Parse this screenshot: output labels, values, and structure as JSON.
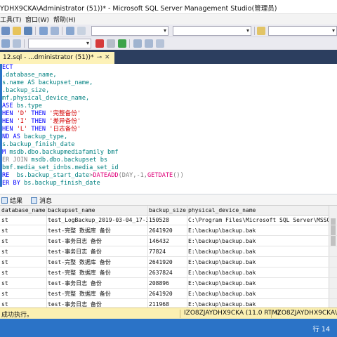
{
  "window": {
    "title": "YDHX9CKA\\Administrator (51))* - Microsoft SQL Server Management Studio(管理员)"
  },
  "menu": {
    "items": [
      "工具(T)",
      "窗口(W)",
      "帮助(H)"
    ]
  },
  "tab": {
    "label": "12.sql - ...dministrator (51))*"
  },
  "code": {
    "lines": [
      [
        {
          "t": "ECT",
          "c": "kw"
        }
      ],
      [
        {
          "t": ".database_name,",
          "c": "tx"
        }
      ],
      [
        {
          "t": "s.name AS backupset_name,",
          "c": "tx"
        }
      ],
      [
        {
          "t": ".backup_size,",
          "c": "tx"
        }
      ],
      [
        {
          "t": "mf.physical_device_name,",
          "c": "tx"
        }
      ],
      [
        {
          "t": "ASE ",
          "c": "kw"
        },
        {
          "t": "bs.type",
          "c": "tx"
        }
      ],
      [
        {
          "t": "HEN ",
          "c": "kw"
        },
        {
          "t": "'D'",
          "c": "str"
        },
        {
          "t": " THEN ",
          "c": "kw"
        },
        {
          "t": "'完整备份'",
          "c": "str"
        }
      ],
      [
        {
          "t": "HEN ",
          "c": "kw"
        },
        {
          "t": "'I'",
          "c": "str"
        },
        {
          "t": " THEN ",
          "c": "kw"
        },
        {
          "t": "'差异备份'",
          "c": "str"
        }
      ],
      [
        {
          "t": "HEN ",
          "c": "kw"
        },
        {
          "t": "'L'",
          "c": "str"
        },
        {
          "t": " THEN ",
          "c": "kw"
        },
        {
          "t": "'日志备份'",
          "c": "str"
        }
      ],
      [
        {
          "t": "ND AS ",
          "c": "kw"
        },
        {
          "t": "backup_type,",
          "c": "tx"
        }
      ],
      [
        {
          "t": "s.backup_finish_date",
          "c": "tx"
        }
      ],
      [
        {
          "t": "M ",
          "c": "kw"
        },
        {
          "t": "msdb.dbo.backupmediafamily bmf",
          "c": "tx"
        }
      ],
      [
        {
          "t": "ER JOIN ",
          "c": "op"
        },
        {
          "t": "msdb.dbo.backupset bs",
          "c": "tx"
        }
      ],
      [
        {
          "t": "bmf.media_set_id=bs.media_set_id",
          "c": "tx"
        }
      ],
      [
        {
          "t": "RE  ",
          "c": "kw"
        },
        {
          "t": "bs.backup_start_date",
          "c": "tx"
        },
        {
          "t": ">",
          "c": "op"
        },
        {
          "t": "DATEADD",
          "c": "fn"
        },
        {
          "t": "(DAY,-1,",
          "c": "op"
        },
        {
          "t": "GETDATE",
          "c": "fn"
        },
        {
          "t": "())",
          "c": "op"
        }
      ],
      [
        {
          "t": "ER BY ",
          "c": "kw"
        },
        {
          "t": "bs.backup_finish_date",
          "c": "tx"
        }
      ]
    ]
  },
  "results": {
    "tabs": [
      "结果",
      "消息"
    ],
    "columns": [
      "database_name",
      "backupset_name",
      "backup_size",
      "physical_device_name"
    ],
    "rows": [
      [
        "st",
        "test_LogBackup_2019-03-04_17-38-32",
        "150528",
        "C:\\Program Files\\Microsoft SQL Server\\MSSQL11.M..."
      ],
      [
        "st",
        "test-完整 数据库 备份",
        "2641920",
        "E:\\backup\\backup.bak"
      ],
      [
        "st",
        "test-事务日志  备份",
        "146432",
        "E:\\backup\\backup.bak"
      ],
      [
        "st",
        "test-事务日志  备份",
        "77824",
        "E:\\backup\\backup.bak"
      ],
      [
        "st",
        "test-完整 数据库 备份",
        "2641920",
        "E:\\backup\\backup.bak"
      ],
      [
        "st",
        "test-完整 数据库 备份",
        "2637824",
        "E:\\backup\\backup.bak"
      ],
      [
        "st",
        "test-事务日志  备份",
        "208896",
        "E:\\backup\\backup.bak"
      ],
      [
        "st",
        "test-完整 数据库 备份",
        "2641920",
        "E:\\backup\\backup.bak"
      ],
      [
        "st",
        "test-事务日志  备份",
        "211968",
        "E:\\backup\\backup.bak"
      ]
    ]
  },
  "status": {
    "message": "成功执行。",
    "server": "IZO8ZJAYDHX9CKA (11.0 RTM)",
    "server2": "IZO8ZJAYDHX9CKA\\Adr"
  },
  "position": {
    "row": "行 14"
  },
  "colors": {
    "tabstrip": "#2c3e5f",
    "active_tab": "#fdf2b8",
    "status_bar": "#fbf0b2",
    "accent_blue": "#2b73c7",
    "keyword": "#0000ff",
    "string": "#d40000",
    "function": "#e0007a"
  }
}
